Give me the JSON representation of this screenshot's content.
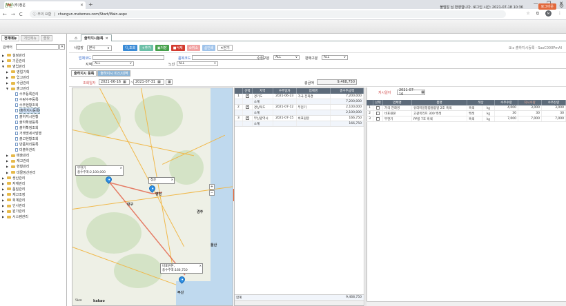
{
  "browser": {
    "tab_title": "(주)청운",
    "tab_favicon": "m",
    "tab_close": "×",
    "new_tab": "+",
    "window_controls": [
      "—",
      "❐",
      "✕"
    ],
    "nav_back": "←",
    "nav_forward": "→",
    "nav_reload": "C",
    "security_label": "ⓘ 주의 요함",
    "url": "chungun.matemes.com/Start/Main.aspx",
    "avatar_letter": "M"
  },
  "header": {
    "logo_text": "청운",
    "welcome": "물엠알 님 환영합니다. 로그인 시간: 2021-07-18 10:36",
    "logout_label": "로그아웃"
  },
  "sidebar": {
    "tabs": [
      "전체메뉴",
      "개인메뉴",
      "즐찾"
    ],
    "search_label": "검색어",
    "search_clear": "✕",
    "tree": [
      {
        "label": "설정관리",
        "level": 0,
        "type": "folder",
        "toggle": "▶"
      },
      {
        "label": "기준관리",
        "level": 0,
        "type": "folder",
        "toggle": "▶"
      },
      {
        "label": "영업관리",
        "level": 0,
        "type": "folder",
        "toggle": "▼"
      },
      {
        "label": "영업기획",
        "level": 1,
        "type": "folder",
        "toggle": "▶"
      },
      {
        "label": "입고관리",
        "level": 1,
        "type": "folder",
        "toggle": "▶"
      },
      {
        "label": "수금관리",
        "level": 1,
        "type": "folder",
        "toggle": "▶"
      },
      {
        "label": "출고관리",
        "level": 1,
        "type": "folder",
        "toggle": "▼"
      },
      {
        "label": "수주등록관리",
        "level": 2,
        "type": "doc"
      },
      {
        "label": "수량수주등록",
        "level": 2,
        "type": "doc"
      },
      {
        "label": "수주현황조회",
        "level": 2,
        "type": "doc"
      },
      {
        "label": "출하지시등록",
        "level": 2,
        "type": "doc",
        "selected": true
      },
      {
        "label": "출하지시현황",
        "level": 2,
        "type": "doc"
      },
      {
        "label": "출하확정등록",
        "level": 2,
        "type": "doc"
      },
      {
        "label": "출하확정조회",
        "level": 2,
        "type": "doc"
      },
      {
        "label": "거래명세서발행",
        "level": 2,
        "type": "doc"
      },
      {
        "label": "출고현황조회",
        "level": 2,
        "type": "doc"
      },
      {
        "label": "반품처리등록",
        "level": 2,
        "type": "doc"
      },
      {
        "label": "미출하관리",
        "level": 2,
        "type": "doc"
      },
      {
        "label": "매출관리",
        "level": 1,
        "type": "folder",
        "toggle": "▶"
      },
      {
        "label": "재고관리",
        "level": 1,
        "type": "folder",
        "toggle": "▶"
      },
      {
        "label": "현황관리",
        "level": 1,
        "type": "folder",
        "toggle": "▶"
      },
      {
        "label": "데몰정산관리",
        "level": 1,
        "type": "folder",
        "toggle": "▶"
      },
      {
        "label": "생산관리",
        "level": 0,
        "type": "folder",
        "toggle": "▶"
      },
      {
        "label": "자재관리",
        "level": 0,
        "type": "folder",
        "toggle": "▶"
      },
      {
        "label": "품질관리",
        "level": 0,
        "type": "folder",
        "toggle": "▶"
      },
      {
        "label": "재고조정",
        "level": 0,
        "type": "folder",
        "toggle": "▶"
      },
      {
        "label": "회계관리",
        "level": 0,
        "type": "folder",
        "toggle": "▶"
      },
      {
        "label": "인사관리",
        "level": 0,
        "type": "folder",
        "toggle": "▶"
      },
      {
        "label": "원가관리",
        "level": 0,
        "type": "folder",
        "toggle": "▶"
      },
      {
        "label": "시스템관리",
        "level": 0,
        "type": "folder",
        "toggle": "▶"
      }
    ]
  },
  "main_tabs": {
    "home_icon": "⌂",
    "current": "출하지시등록",
    "close": "✕"
  },
  "toolbar": {
    "site_label": "사업장",
    "site_value": "본사",
    "buttons": [
      "조회",
      "추가",
      "저장",
      "삭제",
      "취소",
      "인쇄",
      "닫기"
    ],
    "breadcrumb": "⊞ ▸ 출하지시등록 - SasC000PmAl"
  },
  "filters": {
    "customer_code_label": "업체코드",
    "product_code_label": "품목코드",
    "order_type_label": "수주구분",
    "order_type_value": "ALL",
    "sales_type_label": "판매구분",
    "sales_type_value": "ALL",
    "region_label": "지역",
    "region_value": "ALL",
    "route_label": "노선",
    "route_value": "ALL",
    "caret": "∨"
  },
  "inner_tabs": [
    "출하지시 등록",
    "출하지시 미스/내역"
  ],
  "dates": {
    "ship_date_label": "조회일자",
    "from": "2021-06-16",
    "to": "2021-07-31",
    "sep": "~",
    "total_label": "총금액",
    "total_value": "9,468,750",
    "calendar_icon": "▦"
  },
  "map": {
    "cities": [
      "대구",
      "영천",
      "부산",
      "울산",
      "경주"
    ],
    "popups": [
      {
        "line1": "부현기",
        "line2": "총수주액:2,100,000",
        "close": "✕"
      },
      {
        "line1": "청운",
        "line2": "",
        "close": "✕"
      },
      {
        "line1": "비표원본,",
        "line2": "총수주액:166,750",
        "close": "✕"
      }
    ],
    "scale_label": "5km",
    "brand": "kakao",
    "zoom_in": "+",
    "zoom_out": "−"
  },
  "order_grid": {
    "columns": [
      "선택",
      "지역",
      "수주일자",
      "업체명",
      "총수주금액"
    ],
    "rows": [
      {
        "no": "1",
        "checked": true,
        "region": "경기도",
        "date": "2021-06-23",
        "customer": "가국 전화경",
        "amount": "7,200,000",
        "kind": "row"
      },
      {
        "no": "",
        "checked": false,
        "region": "소계",
        "date": "",
        "customer": "",
        "amount": "7,200,000",
        "kind": "sub"
      },
      {
        "no": "2",
        "checked": true,
        "region": "경상북도",
        "date": "2021-07-12",
        "customer": "부현기",
        "amount": "2,100,000",
        "kind": "row"
      },
      {
        "no": "",
        "checked": false,
        "region": "소계",
        "date": "",
        "customer": "",
        "amount": "2,100,000",
        "kind": "sub"
      },
      {
        "no": "3",
        "checked": true,
        "region": "부산광역시",
        "date": "2021-07-15",
        "customer": "비표원본",
        "amount": "166,750",
        "kind": "row"
      },
      {
        "no": "",
        "checked": false,
        "region": "소계",
        "date": "",
        "customer": "",
        "amount": "166,750",
        "kind": "sub"
      }
    ],
    "total_label": "합계",
    "total_value": "9,468,750"
  },
  "detail": {
    "date_label": "지시일자",
    "date_value": "2021-07-16",
    "columns": [
      "선택",
      "업체명",
      "품명",
      "색상",
      "수주수량",
      "지시수량",
      "수주잔량"
    ],
    "rows": [
      {
        "no": "1",
        "customer": "가국 전화경",
        "product": "유리미일정합물람일 2호 흑색",
        "color": "흑색",
        "unit": "㎏",
        "order_qty": "4,000",
        "ship_qty": "3,000",
        "remain": "3,000"
      },
      {
        "no": "2",
        "customer": "비표원본",
        "product": "고광목리프 300 백색",
        "color": "백색",
        "unit": "㎏",
        "order_qty": "30",
        "ship_qty": "30",
        "remain": "30"
      },
      {
        "no": "3",
        "customer": "부현기",
        "product": "PP봉 7호 흑색",
        "color": "흑색",
        "unit": "㎏",
        "order_qty": "7,000",
        "ship_qty": "7,000",
        "remain": "7,000"
      }
    ]
  }
}
